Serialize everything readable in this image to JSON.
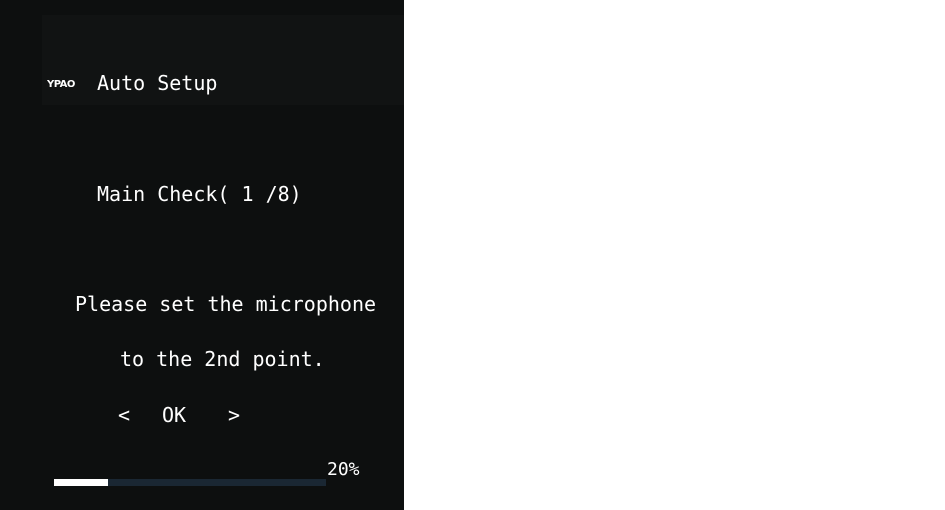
{
  "header": {
    "logo_text": "YPAO",
    "title": "Auto Setup"
  },
  "main": {
    "step_text": "Main Check( 1 /8)",
    "message_line1": "Please set the microphone",
    "message_line2": "to the 2nd point."
  },
  "nav": {
    "prev_label": "<",
    "ok_label": "OK",
    "next_label": ">"
  },
  "progress": {
    "percent_label": "20%",
    "value": 0.2
  },
  "colors": {
    "screen_background": "#0d0f0f",
    "text": "#ffffff",
    "progress_track": "#1a2733",
    "progress_fill": "#ffffff"
  }
}
